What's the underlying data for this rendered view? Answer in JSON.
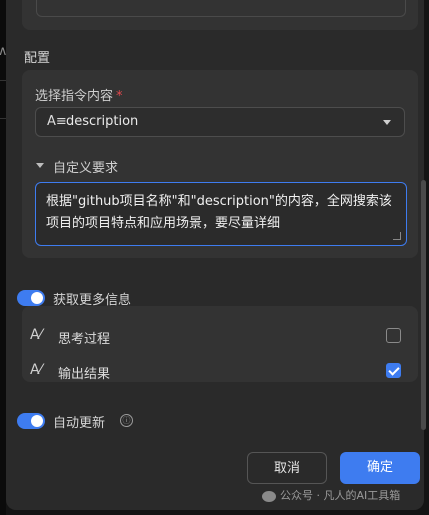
{
  "config_section": {
    "title": "配置"
  },
  "instruction": {
    "label": "选择指令内容",
    "required_mark": "*",
    "selected_value": "description",
    "value_icon": "text-ai-icon"
  },
  "custom_requirement": {
    "label": "自定义要求",
    "text": "根据\"github项目名称\"和\"description\"的内容，全网搜索该项目的项目特点和应用场景，要尽量详细"
  },
  "more_info": {
    "label": "获取更多信息",
    "enabled": true,
    "options": [
      {
        "label": "思考过程",
        "checked": false,
        "icon": "text-sparkle-icon"
      },
      {
        "label": "输出结果",
        "checked": true,
        "icon": "text-sparkle-icon"
      }
    ]
  },
  "auto_update": {
    "label": "自动更新",
    "enabled": true,
    "info_icon": "ⓘ"
  },
  "footer": {
    "cancel_label": "取消",
    "confirm_label": "确定"
  },
  "watermark": "公众号 · 凡人的AI工具箱",
  "colors": {
    "accent": "#3e7cf0",
    "dialog_bg": "#2a2a2a",
    "card_bg": "#333333",
    "required": "#e5484d"
  }
}
